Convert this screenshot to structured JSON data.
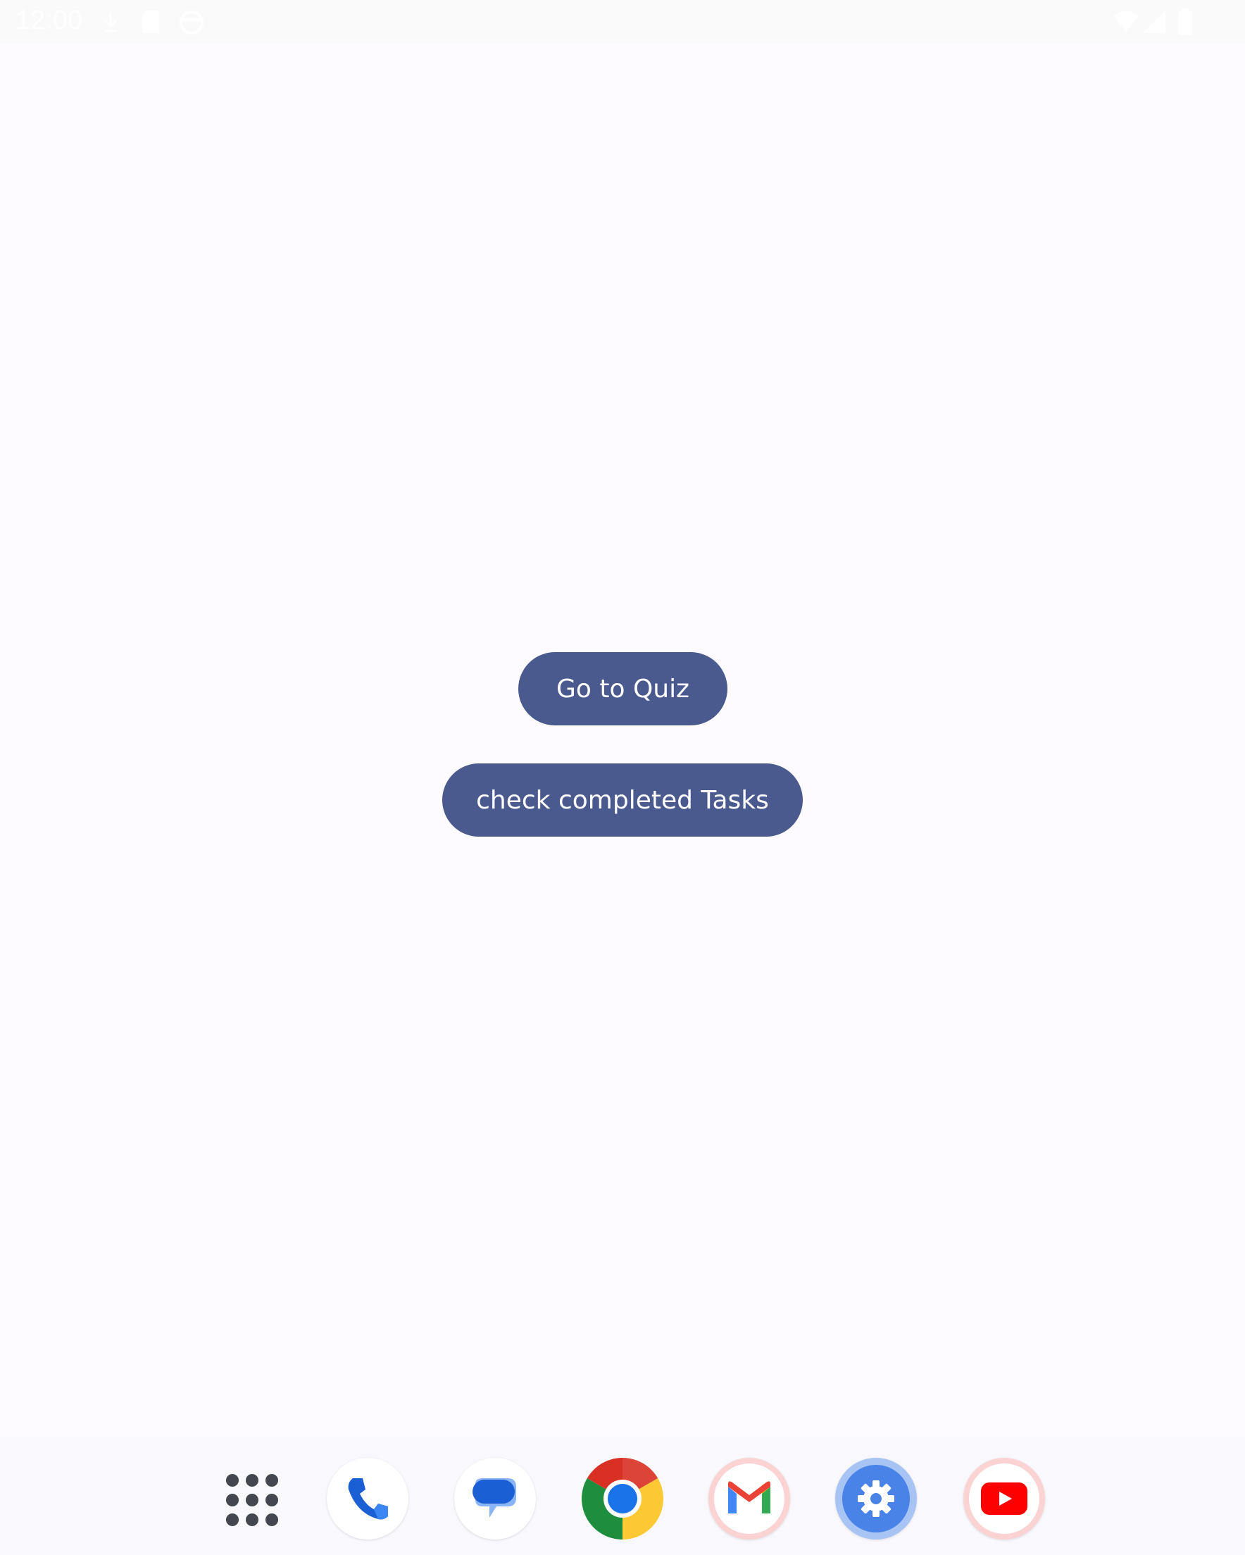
{
  "status_bar": {
    "time": "12:00",
    "icons": [
      "download-icon",
      "sd-card-icon",
      "face-icon",
      "wifi-icon",
      "signal-icon",
      "battery-icon"
    ]
  },
  "main": {
    "quiz_button_label": "Go to Quiz",
    "tasks_button_label": "check completed Tasks"
  },
  "dock": {
    "apps": [
      "app-drawer-icon",
      "phone-icon",
      "messages-icon",
      "chrome-icon",
      "gmail-icon",
      "settings-icon",
      "youtube-icon"
    ]
  },
  "colors": {
    "button_bg": "#4a5a8e",
    "background": "#fdfbff"
  }
}
